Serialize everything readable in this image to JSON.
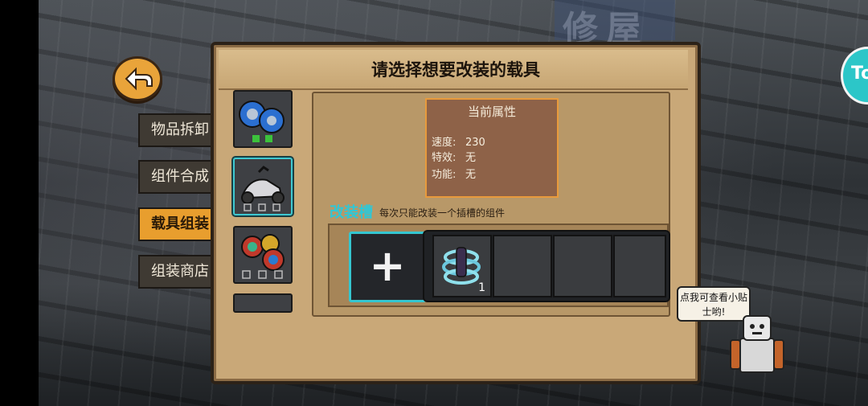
{
  "background": {
    "sign_text": "修屋"
  },
  "side_tabs": [
    {
      "label": "物品拆卸",
      "active": false
    },
    {
      "label": "组件合成",
      "active": false
    },
    {
      "label": "载具组装",
      "active": true
    },
    {
      "label": "组装商店",
      "active": false
    }
  ],
  "panel": {
    "title": "请选择想要改装的载具"
  },
  "vehicles": [
    {
      "name": "wheels-vehicle-icon",
      "selected": false
    },
    {
      "name": "scooter-vehicle-icon",
      "selected": true
    },
    {
      "name": "medals-vehicle-icon",
      "selected": false
    },
    {
      "name": "empty-vehicle-slot",
      "selected": false
    }
  ],
  "attributes": {
    "title": "当前属性",
    "rows": [
      {
        "key": "速度:",
        "value": "230"
      },
      {
        "key": "特效:",
        "value": "无"
      },
      {
        "key": "功能:",
        "value": "无"
      }
    ]
  },
  "mod_slots": {
    "label": "改装槽",
    "hint": "每次只能改装一个插槽的组件",
    "add_symbol": "+",
    "components": [
      {
        "icon": "spring-component-icon",
        "count": "1"
      },
      {
        "icon": "",
        "count": ""
      },
      {
        "icon": "",
        "count": ""
      },
      {
        "icon": "",
        "count": ""
      }
    ]
  },
  "mascot": {
    "speech": "点我可查看小贴士哟!"
  },
  "top_badge": {
    "text": "To"
  },
  "colors": {
    "accent_cyan": "#34c6d0",
    "active_tab": "#e89e2e",
    "panel_bg": "#c9a878",
    "attr_border": "#e89a3c"
  }
}
